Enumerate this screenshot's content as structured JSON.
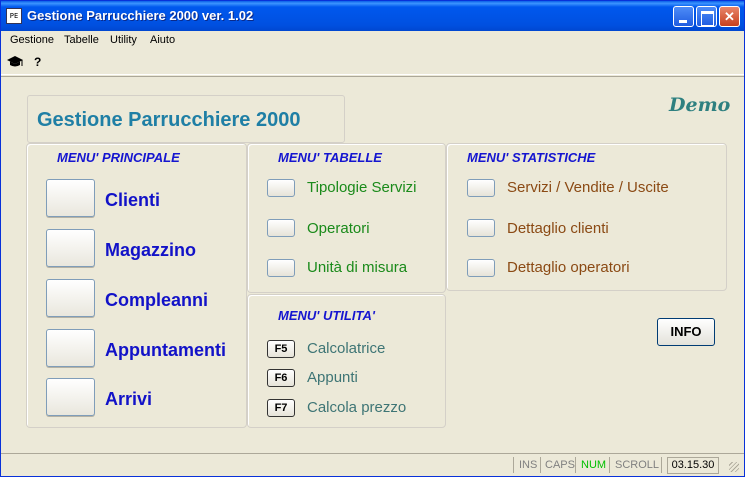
{
  "window": {
    "title": "Gestione Parrucchiere 2000 ver. 1.02",
    "icon_text": "PE"
  },
  "menubar": [
    "Gestione",
    "Tabelle",
    "Utility",
    "Aiuto"
  ],
  "toolbar": {
    "icons": [
      "graduation-cap-icon",
      "help-icon"
    ],
    "help_glyph": "?"
  },
  "header": {
    "app_title": "Gestione Parrucchiere 2000",
    "demo_badge": "Demo"
  },
  "main_menu": {
    "title": "MENU' PRINCIPALE",
    "items": [
      "Clienti",
      "Magazzino",
      "Compleanni",
      "Appuntamenti",
      "Arrivi"
    ]
  },
  "tables_menu": {
    "title": "MENU' TABELLE",
    "items": [
      "Tipologie Servizi",
      "Operatori",
      "Unità di misura"
    ]
  },
  "stats_menu": {
    "title": "MENU' STATISTICHE",
    "items": [
      "Servizi / Vendite / Uscite",
      "Dettaglio clienti",
      "Dettaglio operatori"
    ]
  },
  "utility_menu": {
    "title": "MENU' UTILITA'",
    "items": [
      {
        "key": "F5",
        "label": "Calcolatrice"
      },
      {
        "key": "F6",
        "label": "Appunti"
      },
      {
        "key": "F7",
        "label": "Calcola prezzo"
      }
    ]
  },
  "info_button": "INFO",
  "statusbar": {
    "ins": "INS",
    "caps": "CAPS",
    "num": "NUM",
    "scroll": "SCROLL",
    "clock": "03.15.30",
    "colors": {
      "inactive": "#808080",
      "active": "#00C000"
    }
  }
}
